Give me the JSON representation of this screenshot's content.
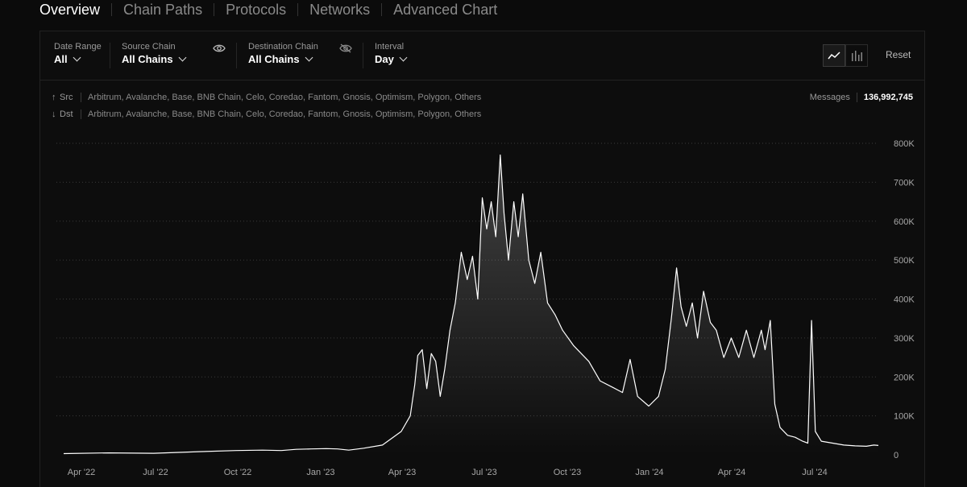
{
  "tabs": [
    {
      "label": "Overview",
      "active": true
    },
    {
      "label": "Chain Paths",
      "active": false
    },
    {
      "label": "Protocols",
      "active": false
    },
    {
      "label": "Networks",
      "active": false
    },
    {
      "label": "Advanced Chart",
      "active": false
    }
  ],
  "filters": {
    "date_range": {
      "label": "Date Range",
      "value": "All"
    },
    "source_chain": {
      "label": "Source Chain",
      "value": "All Chains",
      "icon": "eye-icon"
    },
    "destination_chain": {
      "label": "Destination Chain",
      "value": "All Chains",
      "icon": "eye-off-icon"
    },
    "interval": {
      "label": "Interval",
      "value": "Day"
    }
  },
  "view_toggle": {
    "selected": "line",
    "options": [
      "line-chart-icon",
      "bar-chart-icon"
    ]
  },
  "reset_label": "Reset",
  "routes": {
    "src": {
      "arrow": "↑",
      "label": "Src",
      "chains": "Arbitrum, Avalanche, Base, BNB Chain, Celo, Coredao, Fantom, Gnosis, Optimism, Polygon, Others"
    },
    "dst": {
      "arrow": "↓",
      "label": "Dst",
      "chains": "Arbitrum, Avalanche, Base, BNB Chain, Celo, Coredao, Fantom, Gnosis, Optimism, Polygon, Others"
    }
  },
  "messages": {
    "label": "Messages",
    "value": "136,992,745"
  },
  "colors": {
    "line": "#ffffff",
    "grid": "#3a3a3a",
    "background": "#0b0b0b"
  },
  "chart_data": {
    "type": "area",
    "title": "",
    "xlabel": "",
    "ylabel": "",
    "x_ticks": [
      "Apr '22",
      "Jul '22",
      "Oct '22",
      "Jan '23",
      "Apr '23",
      "Jul '23",
      "Oct '23",
      "Jan '24",
      "Apr '24",
      "Jul '24"
    ],
    "y_ticks": [
      "0",
      "100K",
      "200K",
      "300K",
      "400K",
      "500K",
      "600K",
      "700K",
      "800K"
    ],
    "ylim": [
      0,
      800000
    ],
    "grid": true,
    "series": [
      {
        "values": [
          [
            0,
            3000
          ],
          [
            60,
            5000
          ],
          [
            120,
            4000
          ],
          [
            180,
            8000
          ],
          [
            230,
            11000
          ],
          [
            265,
            12000
          ],
          [
            290,
            11000
          ],
          [
            310,
            14000
          ],
          [
            330,
            15000
          ],
          [
            350,
            16000
          ],
          [
            365,
            15000
          ],
          [
            380,
            12000
          ],
          [
            400,
            17000
          ],
          [
            425,
            25000
          ],
          [
            450,
            60000
          ],
          [
            462,
            100000
          ],
          [
            468,
            180000
          ],
          [
            472,
            255000
          ],
          [
            478,
            270000
          ],
          [
            484,
            170000
          ],
          [
            490,
            260000
          ],
          [
            496,
            240000
          ],
          [
            502,
            150000
          ],
          [
            508,
            220000
          ],
          [
            515,
            320000
          ],
          [
            522,
            390000
          ],
          [
            530,
            520000
          ],
          [
            538,
            450000
          ],
          [
            545,
            510000
          ],
          [
            552,
            400000
          ],
          [
            558,
            660000
          ],
          [
            564,
            580000
          ],
          [
            570,
            650000
          ],
          [
            576,
            560000
          ],
          [
            582,
            770000
          ],
          [
            587,
            620000
          ],
          [
            593,
            500000
          ],
          [
            600,
            650000
          ],
          [
            606,
            560000
          ],
          [
            612,
            670000
          ],
          [
            620,
            500000
          ],
          [
            628,
            440000
          ],
          [
            636,
            520000
          ],
          [
            645,
            390000
          ],
          [
            655,
            360000
          ],
          [
            665,
            320000
          ],
          [
            680,
            280000
          ],
          [
            700,
            240000
          ],
          [
            715,
            190000
          ],
          [
            730,
            175000
          ],
          [
            745,
            160000
          ],
          [
            755,
            245000
          ],
          [
            765,
            150000
          ],
          [
            780,
            125000
          ],
          [
            793,
            150000
          ],
          [
            802,
            220000
          ],
          [
            810,
            350000
          ],
          [
            817,
            480000
          ],
          [
            823,
            380000
          ],
          [
            830,
            330000
          ],
          [
            838,
            390000
          ],
          [
            845,
            300000
          ],
          [
            853,
            420000
          ],
          [
            862,
            340000
          ],
          [
            870,
            320000
          ],
          [
            880,
            250000
          ],
          [
            890,
            300000
          ],
          [
            900,
            250000
          ],
          [
            910,
            320000
          ],
          [
            920,
            250000
          ],
          [
            930,
            320000
          ],
          [
            935,
            270000
          ],
          [
            942,
            345000
          ],
          [
            948,
            130000
          ],
          [
            955,
            70000
          ],
          [
            965,
            50000
          ],
          [
            975,
            45000
          ],
          [
            985,
            35000
          ],
          [
            992,
            30000
          ],
          [
            997,
            345000
          ],
          [
            1002,
            60000
          ],
          [
            1010,
            35000
          ],
          [
            1025,
            30000
          ],
          [
            1040,
            25000
          ],
          [
            1055,
            23000
          ],
          [
            1070,
            22000
          ],
          [
            1080,
            25000
          ],
          [
            1086,
            24000
          ]
        ]
      }
    ]
  }
}
